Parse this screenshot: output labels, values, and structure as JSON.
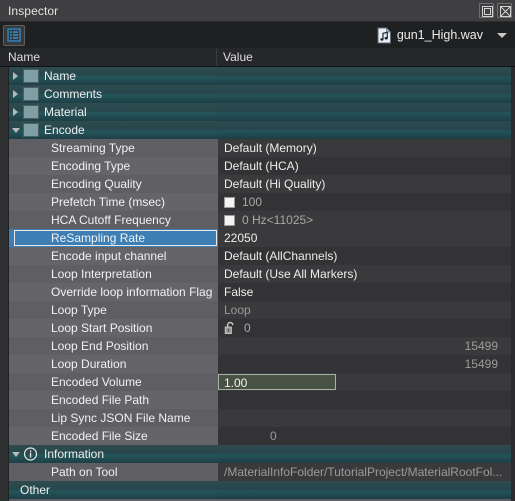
{
  "window": {
    "title": "Inspector",
    "float_button": "float-restore",
    "close_button": "close"
  },
  "toolbar": {
    "list_icon": "properties-list-icon",
    "file_icon": "audio-file-icon",
    "file_name": "gun1_High.wav",
    "dropdown_icon": "chevron-down-icon"
  },
  "columns": {
    "name": "Name",
    "value": "Value"
  },
  "rows": [
    {
      "label": "Name",
      "value": "",
      "kind": "group",
      "icon": "name-icon",
      "expanded": false
    },
    {
      "label": "Comments",
      "value": "",
      "kind": "group",
      "icon": "comments-icon",
      "expanded": false
    },
    {
      "label": "Material",
      "value": "",
      "kind": "group",
      "icon": "material-icon",
      "expanded": false
    },
    {
      "label": "Encode",
      "value": "",
      "kind": "group",
      "icon": "encode-icon",
      "expanded": true
    },
    {
      "label": "Streaming Type",
      "value": "Default (Memory)",
      "kind": "prop"
    },
    {
      "label": "Encoding Type",
      "value": "Default (HCA)",
      "kind": "prop"
    },
    {
      "label": "Encoding Quality",
      "value": "Default (Hi Quality)",
      "kind": "prop"
    },
    {
      "label": "Prefetch Time (msec)",
      "value": "100",
      "kind": "checkbox",
      "checked": false,
      "disabled": true
    },
    {
      "label": "HCA Cutoff Frequency",
      "value": "0 Hz<11025>",
      "kind": "checkbox",
      "checked": false,
      "disabled": true
    },
    {
      "label": "ReSampling Rate",
      "value": "22050",
      "kind": "prop",
      "selected": true
    },
    {
      "label": "Encode input channel",
      "value": "Default (AllChannels)",
      "kind": "prop"
    },
    {
      "label": "Loop Interpretation",
      "value": "Default (Use All Markers)",
      "kind": "prop"
    },
    {
      "label": "Override loop information Flag",
      "value": "False",
      "kind": "prop"
    },
    {
      "label": "Loop Type",
      "value": "Loop",
      "kind": "prop",
      "disabled": true
    },
    {
      "label": "Loop Start Position",
      "value": "0",
      "kind": "lock",
      "locked": false,
      "disabled": true
    },
    {
      "label": "Loop End Position",
      "value": "15499",
      "kind": "prop",
      "disabled": true,
      "align": "right"
    },
    {
      "label": "Loop Duration",
      "value": "15499",
      "kind": "prop",
      "disabled": true,
      "align": "right"
    },
    {
      "label": "Encoded Volume",
      "value": "1.00",
      "kind": "editfield"
    },
    {
      "label": "Encoded File Path",
      "value": "",
      "kind": "prop"
    },
    {
      "label": "Lip Sync JSON File Name",
      "value": "",
      "kind": "prop"
    },
    {
      "label": "Encoded File Size",
      "value": "0",
      "kind": "prop",
      "disabled": true,
      "align": "left-indent"
    },
    {
      "label": "Information",
      "value": "",
      "kind": "group",
      "icon": "info-icon",
      "expanded": true
    },
    {
      "label": "Path on Tool",
      "value": "/MaterialInfoFolder/TutorialProject/MaterialRootFol...",
      "kind": "prop",
      "disabled": true
    },
    {
      "label": "Other",
      "value": "",
      "kind": "group-plain"
    }
  ],
  "colors": {
    "selection_blue": "#3d7fb5",
    "group_teal": "#245458",
    "panel_bg": "#252526",
    "row_light": "#5e5e63",
    "row_dark": "#3a3a3c",
    "edit_green": "#485244"
  }
}
